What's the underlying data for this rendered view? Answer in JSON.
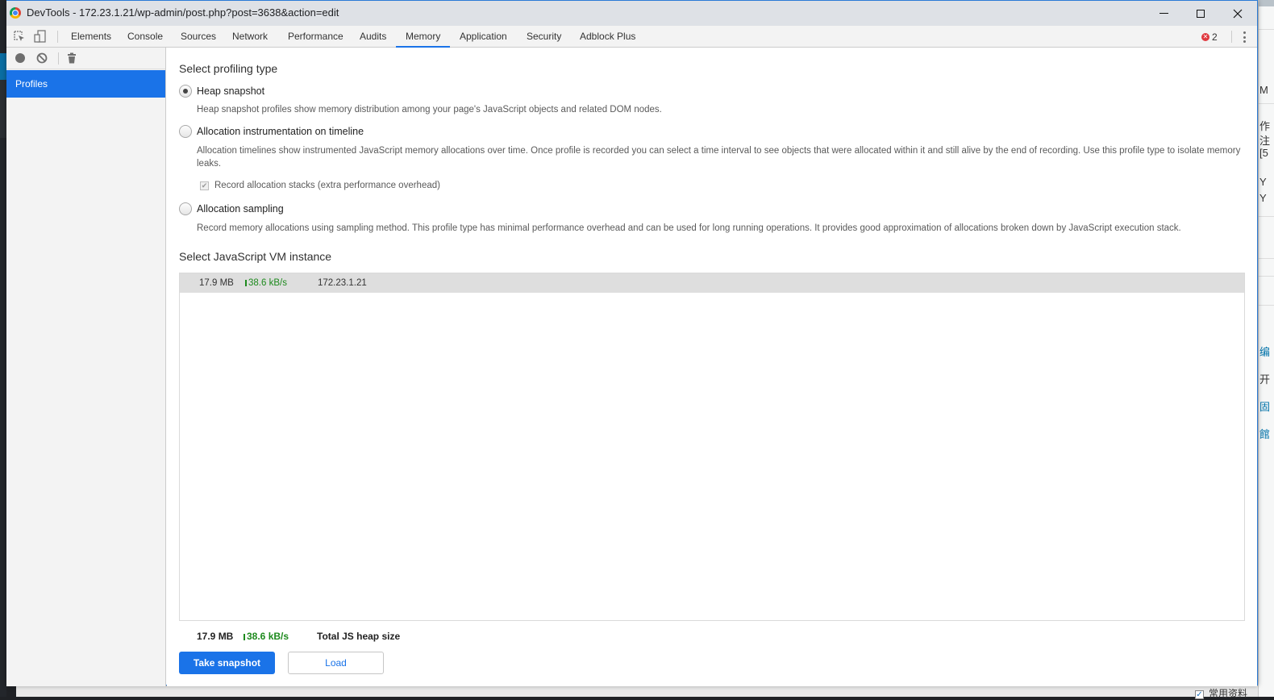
{
  "window": {
    "title": "DevTools - 172.23.1.21/wp-admin/post.php?post=3638&action=edit",
    "controls": [
      "minimize",
      "maximize",
      "close"
    ]
  },
  "toolbar": {
    "tabs": [
      {
        "label": "Elements"
      },
      {
        "label": "Console"
      },
      {
        "label": "Sources"
      },
      {
        "label": "Network"
      },
      {
        "label": "Performance"
      },
      {
        "label": "Audits"
      },
      {
        "label": "Memory",
        "active": true
      },
      {
        "label": "Application"
      },
      {
        "label": "Security"
      },
      {
        "label": "Adblock Plus"
      }
    ],
    "error_count": "2",
    "icons": [
      "inspect-element-icon",
      "device-toolbar-icon",
      "error-icon",
      "more-options-icon"
    ]
  },
  "sidebar": {
    "tools": [
      "record-icon",
      "clear-icon",
      "trash-icon"
    ],
    "items": [
      {
        "label": "Profiles",
        "selected": true
      }
    ]
  },
  "main": {
    "profiling_heading": "Select profiling type",
    "options": [
      {
        "label": "Heap snapshot",
        "selected": true,
        "description": "Heap snapshot profiles show memory distribution among your page's JavaScript objects and related DOM nodes."
      },
      {
        "label": "Allocation instrumentation on timeline",
        "selected": false,
        "description": "Allocation timelines show instrumented JavaScript memory allocations over time. Once profile is recorded you can select a time interval to see objects that were allocated within it and still alive by the end of recording. Use this profile type to isolate memory leaks.",
        "checkbox": {
          "label": "Record allocation stacks (extra performance overhead)",
          "checked": true,
          "disabled": true
        }
      },
      {
        "label": "Allocation sampling",
        "selected": false,
        "description": "Record memory allocations using sampling method. This profile type has minimal performance overhead and can be used for long running operations. It provides good approximation of allocations broken down by JavaScript execution stack."
      }
    ],
    "vm_heading": "Select JavaScript VM instance",
    "vm_instances": [
      {
        "size": "17.9 MB",
        "rate": "38.6 kB/s",
        "host": "172.23.1.21"
      }
    ],
    "summary": {
      "size": "17.9 MB",
      "rate": "38.6 kB/s",
      "label": "Total JS heap size"
    },
    "buttons": {
      "take_snapshot": "Take snapshot",
      "load": "Load"
    }
  },
  "background": {
    "right_edge_chars": [
      "M",
      "作",
      "注",
      "[5",
      "Y",
      "Y",
      "编",
      "开",
      "固",
      "館"
    ],
    "bottom_checkbox_label": "常用资料"
  },
  "colors": {
    "accent": "#1a73e8",
    "rate_green": "#1d8a1d",
    "error_red": "#e0383e"
  }
}
